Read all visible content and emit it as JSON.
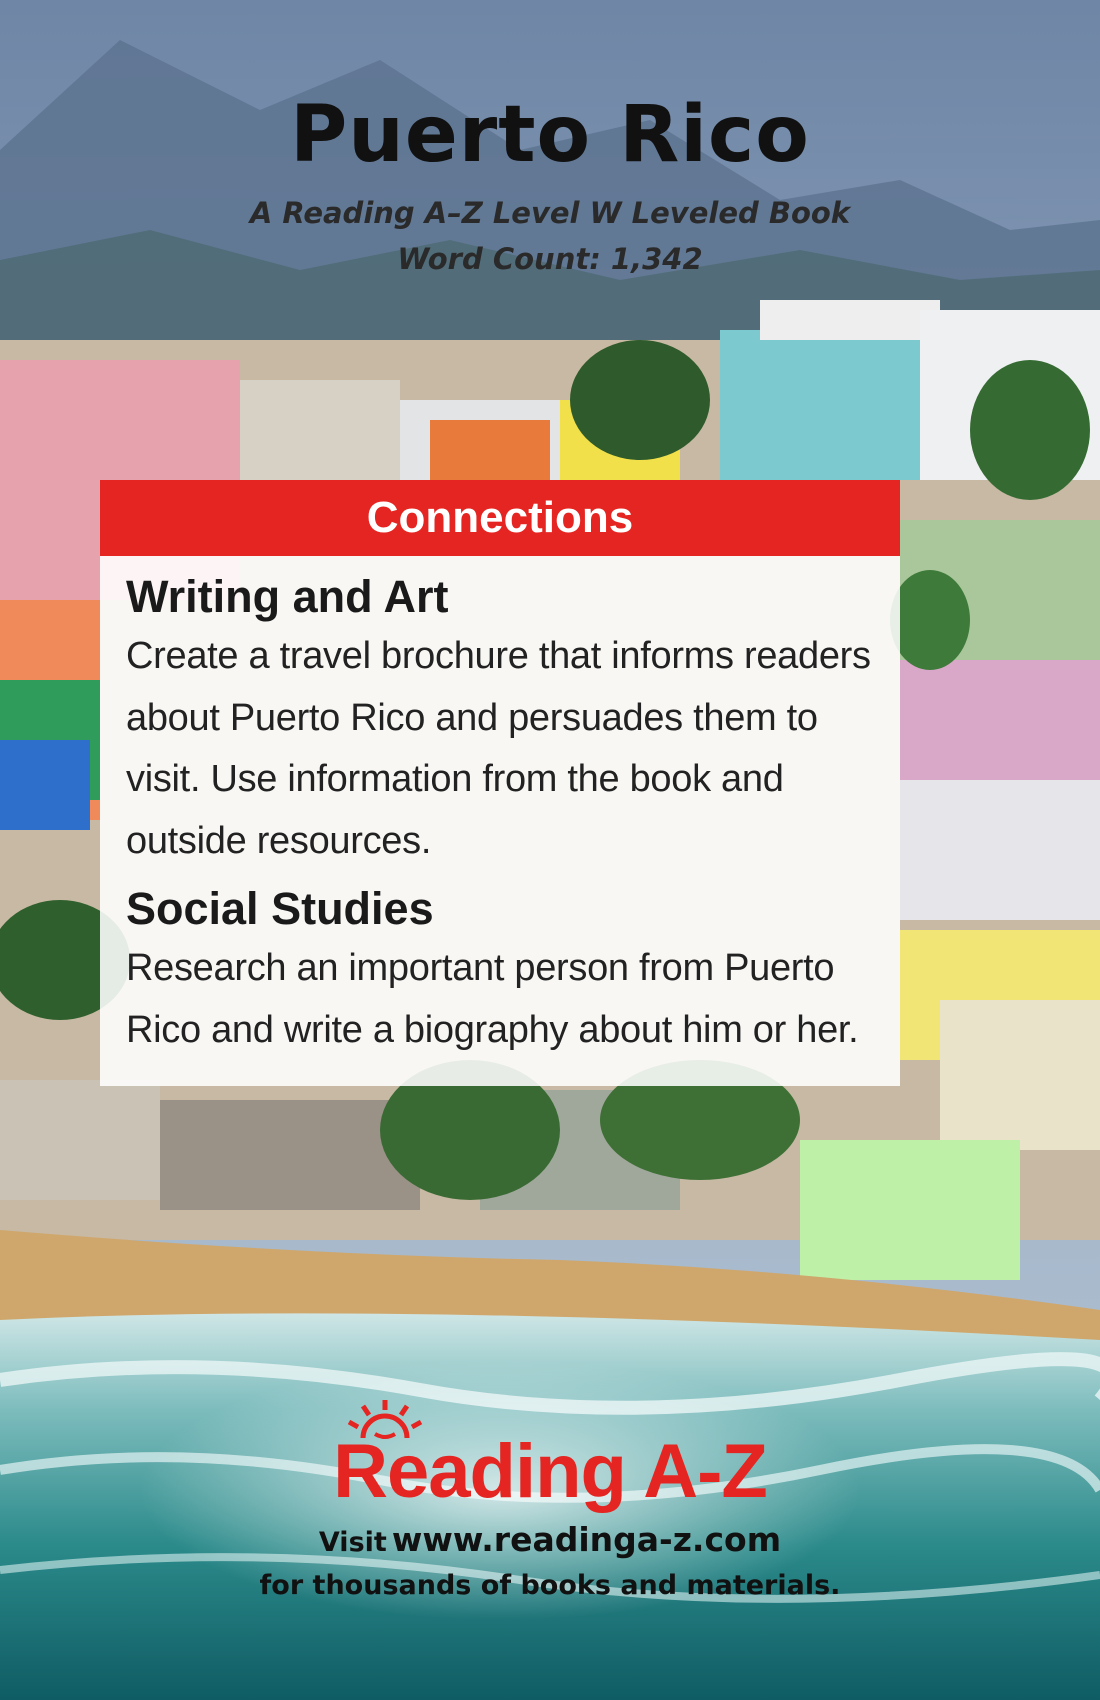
{
  "cover": {
    "title": "Puerto Rico",
    "subtitle": "A Reading A–Z Level W Leveled Book",
    "word_count": "Word Count: 1,342"
  },
  "connections": {
    "header": "Connections",
    "sections": [
      {
        "title": "Writing and Art",
        "text": "Create a travel brochure that informs readers about Puerto Rico and persuades them to visit. Use information from the book and outside resources."
      },
      {
        "title": "Social Studies",
        "text": "Research an important person from Puerto Rico and write a biography about him or her."
      }
    ]
  },
  "footer": {
    "logo_text": "Reading A-Z",
    "visit_label": "Visit",
    "url": "www.readinga-z.com",
    "tagline": "for thousands of books and materials."
  },
  "colors": {
    "brand_red": "#e52521",
    "sky": "#7f95b4",
    "sea": "#2b8a8a"
  }
}
